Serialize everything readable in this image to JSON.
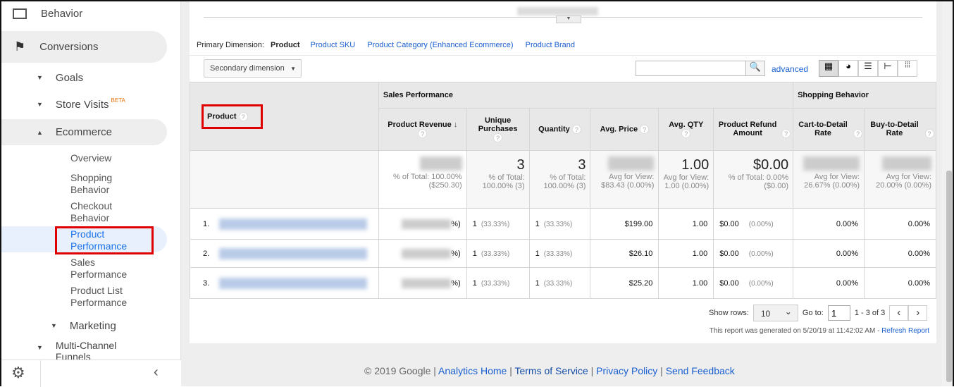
{
  "sidebar": {
    "behavior": "Behavior",
    "conversions": "Conversions",
    "goals": "Goals",
    "store_visits": "Store Visits",
    "beta": "BETA",
    "ecommerce": "Ecommerce",
    "items": [
      "Overview",
      "Shopping Behavior",
      "Checkout Behavior",
      "Product Performance",
      "Sales Performance",
      "Product List Performance"
    ],
    "marketing": "Marketing",
    "multichannel": "Multi-Channel Funnels"
  },
  "dimensions": {
    "label": "Primary Dimension:",
    "active": "Product",
    "links": [
      "Product SKU",
      "Product Category (Enhanced Ecommerce)",
      "Product Brand"
    ]
  },
  "toolbar": {
    "secondary": "Secondary dimension",
    "search_value": "",
    "advanced": "advanced"
  },
  "table": {
    "product_header": "Product",
    "group1": "Sales Performance",
    "group2": "Shopping Behavior",
    "columns": [
      "Product Revenue",
      "Unique Purchases",
      "Quantity",
      "Avg. Price",
      "Avg. QTY",
      "Product Refund Amount",
      "Cart-to-Detail Rate",
      "Buy-to-Detail Rate"
    ],
    "totals": {
      "revenue_sub": "% of Total: 100.00% ($250.30)",
      "unique": "3",
      "unique_sub": "% of Total: 100.00% (3)",
      "quantity": "3",
      "quantity_sub": "% of Total: 100.00% (3)",
      "price_sub": "Avg for View: $83.43 (0.00%)",
      "qty": "1.00",
      "qty_sub": "Avg for View: 1.00 (0.00%)",
      "refund": "$0.00",
      "refund_sub": "% of Total: 0.00% ($0.00)",
      "cart_sub": "Avg for View: 26.67% (0.00%)",
      "buy_sub": "Avg for View: 20.00% (0.00%)"
    },
    "rows": [
      {
        "n": "1.",
        "rev_pct": "%)",
        "unique": "1",
        "unique_pct": "(33.33%)",
        "qty": "1",
        "qty_pct": "(33.33%)",
        "price": "$199.00",
        "avgqty": "1.00",
        "refund": "$0.00",
        "refund_pct": "(0.00%)",
        "cart": "0.00%",
        "buy": "0.00%"
      },
      {
        "n": "2.",
        "rev_pct": "%)",
        "unique": "1",
        "unique_pct": "(33.33%)",
        "qty": "1",
        "qty_pct": "(33.33%)",
        "price": "$26.10",
        "avgqty": "1.00",
        "refund": "$0.00",
        "refund_pct": "(0.00%)",
        "cart": "0.00%",
        "buy": "0.00%"
      },
      {
        "n": "3.",
        "rev_pct": "%)",
        "unique": "1",
        "unique_pct": "(33.33%)",
        "qty": "1",
        "qty_pct": "(33.33%)",
        "price": "$25.20",
        "avgqty": "1.00",
        "refund": "$0.00",
        "refund_pct": "(0.00%)",
        "cart": "0.00%",
        "buy": "0.00%"
      }
    ]
  },
  "pagination": {
    "show_rows": "Show rows:",
    "rows_value": "10",
    "goto": "Go to:",
    "goto_value": "1",
    "range": "1 - 3 of 3"
  },
  "report": {
    "generated": "This report was generated on 5/20/19 at 11:42:02 AM - ",
    "refresh": "Refresh Report"
  },
  "footer": {
    "copyright": "© 2019 Google",
    "links": [
      "Analytics Home",
      "Terms of Service",
      "Privacy Policy",
      "Send Feedback"
    ]
  },
  "colors": {
    "accent": "#1a73e8",
    "highlight": "#e00000"
  }
}
